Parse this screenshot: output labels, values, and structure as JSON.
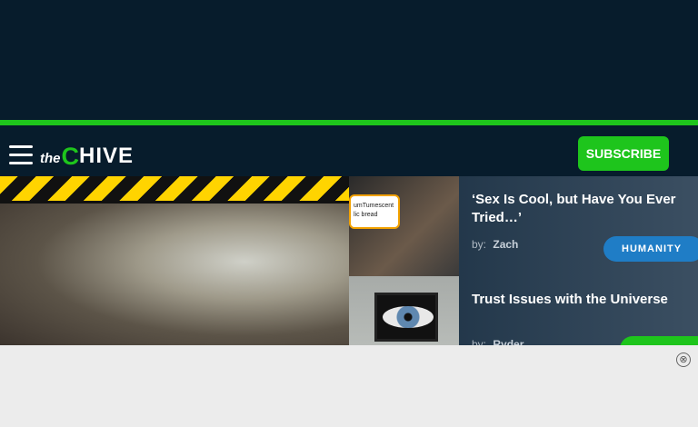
{
  "header": {
    "logo": {
      "the": "the",
      "c": "C",
      "hive": "HIVE"
    },
    "subscribe_label": "SUBSCRIBE"
  },
  "articles": [
    {
      "title": "‘Sex Is Cool, but Have You Ever Tried…’",
      "by_label": "by:",
      "author": "Zach",
      "category": "HUMANITY",
      "thumb_text": "umTumescent\nlic bread"
    },
    {
      "title": "Trust Issues with the Universe",
      "by_label": "by:",
      "author": "Ryder"
    }
  ],
  "ad": {
    "close_icon": "⊗"
  },
  "colors": {
    "brand_green": "#1ec51c",
    "navy": "#071c2c",
    "tag_blue": "#1f7dc6"
  }
}
